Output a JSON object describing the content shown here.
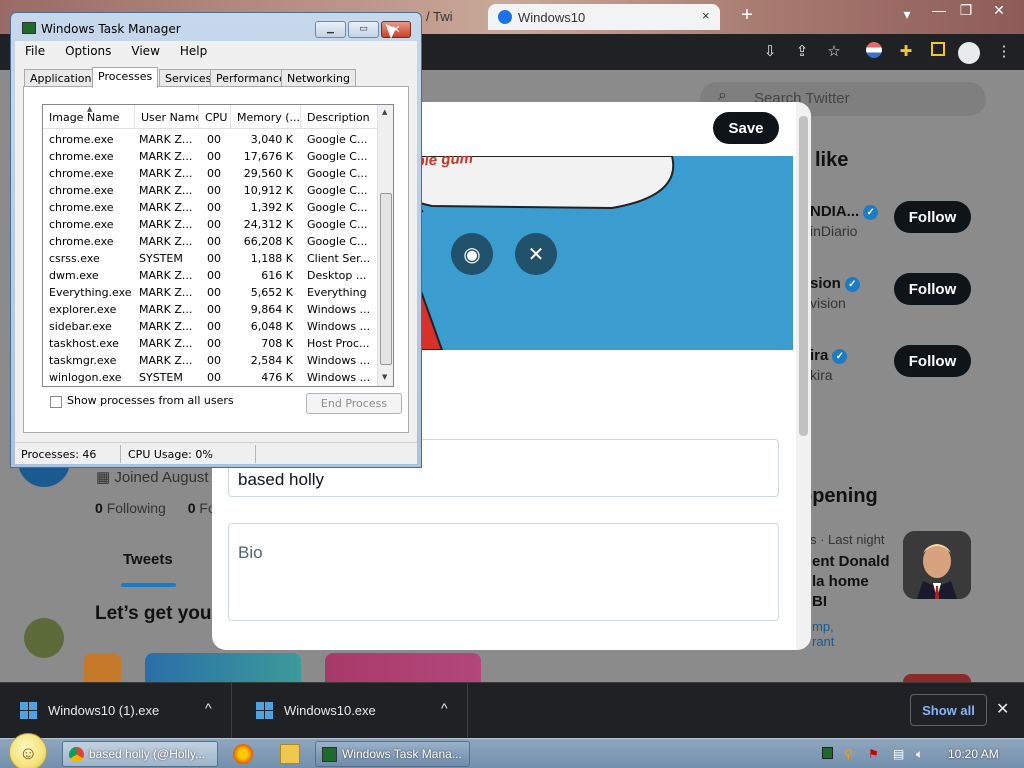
{
  "chrome": {
    "tabs": [
      {
        "label": "/ Twi",
        "x": "×"
      },
      {
        "label": "Windows10"
      }
    ],
    "new_tab": "+",
    "window_controls": [
      "▾",
      "—",
      "❐",
      "✕"
    ]
  },
  "twitter": {
    "search_placeholder": "Search Twitter",
    "who_to_follow_title": "like",
    "suggestions": [
      {
        "name": "NDIA...",
        "handle": "inDiario",
        "follow": "Follow"
      },
      {
        "name": "sion",
        "handle": "vision",
        "follow": "Follow"
      },
      {
        "name": "ira",
        "handle": "kira",
        "follow": "Follow"
      }
    ],
    "happening_title": "ppening",
    "trend_meta": "s · Last night",
    "trend_text": "ent Donald\nla home\nBI",
    "trend_links": "mp,\nrant",
    "joined": "Joined August",
    "following_count": "0",
    "following_label": "Following",
    "followers_count": "0",
    "followers_label": "Fo",
    "tab_tweets": "Tweets",
    "lets_get": "Let’s get you"
  },
  "modal": {
    "save": "Save",
    "banner_caption": "bubble gum",
    "name_value": "based holly",
    "bio_placeholder": "Bio"
  },
  "taskmanager": {
    "title": "Windows Task Manager",
    "menu": [
      "File",
      "Options",
      "View",
      "Help"
    ],
    "tabs": [
      "Applications",
      "Processes",
      "Services",
      "Performance",
      "Networking"
    ],
    "active_tab": "Processes",
    "columns": [
      "Image Name",
      "User Name",
      "CPU",
      "Memory (...",
      "Description"
    ],
    "rows": [
      [
        "chrome.exe",
        "MARK Z...",
        "00",
        "3,040 K",
        "Google C..."
      ],
      [
        "chrome.exe",
        "MARK Z...",
        "00",
        "17,676 K",
        "Google C..."
      ],
      [
        "chrome.exe",
        "MARK Z...",
        "00",
        "29,560 K",
        "Google C..."
      ],
      [
        "chrome.exe",
        "MARK Z...",
        "00",
        "10,912 K",
        "Google C..."
      ],
      [
        "chrome.exe",
        "MARK Z...",
        "00",
        "1,392 K",
        "Google C..."
      ],
      [
        "chrome.exe",
        "MARK Z...",
        "00",
        "24,312 K",
        "Google C..."
      ],
      [
        "chrome.exe",
        "MARK Z...",
        "00",
        "66,208 K",
        "Google C..."
      ],
      [
        "csrss.exe",
        "SYSTEM",
        "00",
        "1,188 K",
        "Client Ser..."
      ],
      [
        "dwm.exe",
        "MARK Z...",
        "00",
        "616 K",
        "Desktop ..."
      ],
      [
        "Everything.exe",
        "MARK Z...",
        "00",
        "5,652 K",
        "Everything"
      ],
      [
        "explorer.exe",
        "MARK Z...",
        "00",
        "9,864 K",
        "Windows ..."
      ],
      [
        "sidebar.exe",
        "MARK Z...",
        "00",
        "6,048 K",
        "Windows ..."
      ],
      [
        "taskhost.exe",
        "MARK Z...",
        "00",
        "708 K",
        "Host Proc..."
      ],
      [
        "taskmgr.exe",
        "MARK Z...",
        "00",
        "2,584 K",
        "Windows ..."
      ],
      [
        "winlogon.exe",
        "SYSTEM",
        "00",
        "476 K",
        "Windows ..."
      ]
    ],
    "show_all_users": "Show processes from all users",
    "end_process": "End Process",
    "status_processes": "Processes: 46",
    "status_cpu": "CPU Usage: 0%"
  },
  "downloads": {
    "items": [
      {
        "name": "Windows10 (1).exe",
        "caret": "^"
      },
      {
        "name": "Windows10.exe",
        "caret": "^"
      }
    ],
    "show_all": "Show all",
    "close": "✕"
  },
  "taskbar": {
    "buttons": [
      {
        "label": "based holly (@Holly..."
      },
      {
        "label": "Windows Task Mana..."
      }
    ],
    "clock": "10:20 AM"
  },
  "colors": {
    "twitter_blue": "#1d9bf0",
    "twitter_dark": "#0f1419",
    "chrome_dark": "#202124",
    "download_link": "#8ab4f8"
  }
}
